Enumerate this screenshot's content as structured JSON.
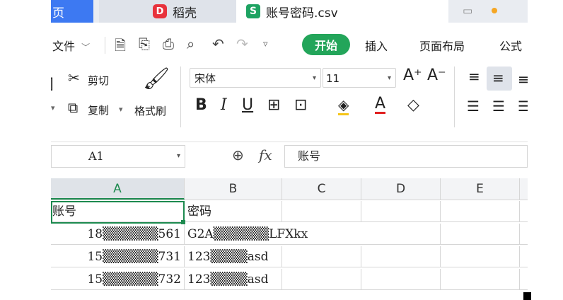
{
  "tabs": {
    "home": "页",
    "daoke": "稻壳",
    "file": "账号密码.csv"
  },
  "menu": {
    "file": "文件",
    "start": "开始",
    "insert": "插入",
    "page_layout": "页面布局",
    "formula": "公式"
  },
  "ribbon": {
    "cut": "剪切",
    "copy": "复制",
    "format_painter": "格式刷",
    "font_name": "宋体",
    "font_size": "11"
  },
  "formula_bar": {
    "cell_ref": "A1",
    "fx": "fx",
    "content": "账号"
  },
  "sheet": {
    "columns": [
      "A",
      "B",
      "C",
      "D",
      "E"
    ],
    "rows": [
      [
        "账号",
        "密码"
      ],
      [
        "18▒▒▒▒▒▒561",
        "G2A▒▒▒▒▒▒LFXkx"
      ],
      [
        "15▒▒▒▒▒▒731",
        "123▒▒▒▒asd"
      ],
      [
        "15▒▒▒▒▒▒732",
        "123▒▒▒▒asd"
      ]
    ]
  },
  "colors": {
    "accent_green": "#1d8a4f",
    "start_button": "#23a55a",
    "home_tab": "#3d79f2"
  }
}
